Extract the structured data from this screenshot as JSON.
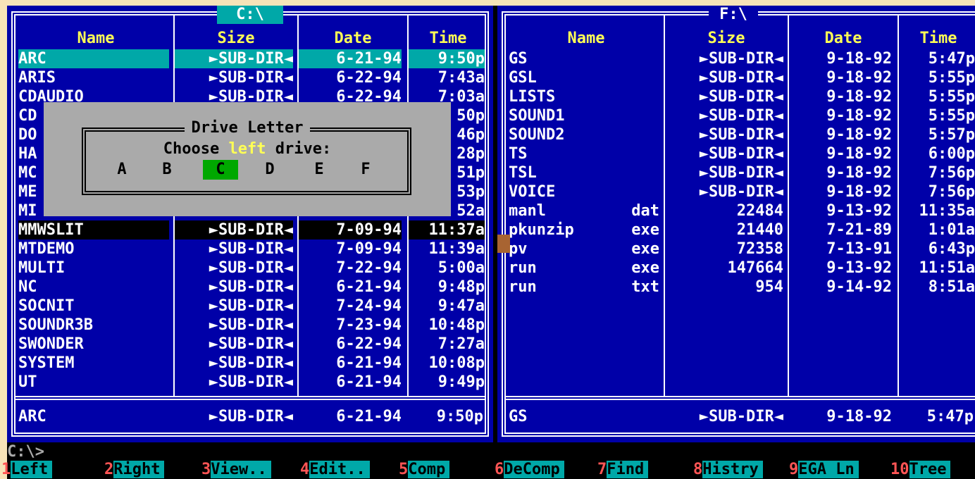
{
  "left_panel": {
    "drive": "C:\\",
    "headers": [
      "Name",
      "Size",
      "Date",
      "Time"
    ],
    "rows": [
      {
        "name": "ARC",
        "ext": "",
        "size": "►SUB-DIR◄",
        "date": "6-21-94",
        "time": "9:50p"
      },
      {
        "name": "ARIS",
        "ext": "",
        "size": "►SUB-DIR◄",
        "date": "6-22-94",
        "time": "7:43a"
      },
      {
        "name": "CDAUDIO",
        "ext": "",
        "size": "►SUB-DIR◄",
        "date": "6-22-94",
        "time": "7:03a"
      },
      {
        "name": "CD",
        "ext": "",
        "size": "",
        "date": "",
        "time": "50p"
      },
      {
        "name": "DO",
        "ext": "",
        "size": "",
        "date": "",
        "time": "46p"
      },
      {
        "name": "HA",
        "ext": "",
        "size": "",
        "date": "",
        "time": "28p"
      },
      {
        "name": "MC",
        "ext": "",
        "size": "",
        "date": "",
        "time": "51p"
      },
      {
        "name": "ME",
        "ext": "",
        "size": "",
        "date": "",
        "time": "53p"
      },
      {
        "name": "MI",
        "ext": "",
        "size": "",
        "date": "",
        "time": "52a"
      },
      {
        "name": "MMWSLIT",
        "ext": "",
        "size": "►SUB-DIR◄",
        "date": "7-09-94",
        "time": "11:37a"
      },
      {
        "name": "MTDEMO",
        "ext": "",
        "size": "►SUB-DIR◄",
        "date": "7-09-94",
        "time": "11:39a"
      },
      {
        "name": "MULTI",
        "ext": "",
        "size": "►SUB-DIR◄",
        "date": "7-22-94",
        "time": "5:00a"
      },
      {
        "name": "NC",
        "ext": "",
        "size": "►SUB-DIR◄",
        "date": "6-21-94",
        "time": "9:48p"
      },
      {
        "name": "SOCNIT",
        "ext": "",
        "size": "►SUB-DIR◄",
        "date": "7-24-94",
        "time": "9:47a"
      },
      {
        "name": "SOUNDR3B",
        "ext": "",
        "size": "►SUB-DIR◄",
        "date": "7-23-94",
        "time": "10:48p"
      },
      {
        "name": "SWONDER",
        "ext": "",
        "size": "►SUB-DIR◄",
        "date": "6-22-94",
        "time": "7:27a"
      },
      {
        "name": "SYSTEM",
        "ext": "",
        "size": "►SUB-DIR◄",
        "date": "6-21-94",
        "time": "10:08p"
      },
      {
        "name": "UT",
        "ext": "",
        "size": "►SUB-DIR◄",
        "date": "6-21-94",
        "time": "9:49p"
      }
    ],
    "status": {
      "name": "ARC",
      "size": "►SUB-DIR◄",
      "date": "6-21-94",
      "time": "9:50p"
    }
  },
  "right_panel": {
    "drive": "F:\\",
    "headers": [
      "Name",
      "Size",
      "Date",
      "Time"
    ],
    "rows": [
      {
        "name": "GS",
        "ext": "",
        "size": "►SUB-DIR◄",
        "date": "9-18-92",
        "time": "5:47p"
      },
      {
        "name": "GSL",
        "ext": "",
        "size": "►SUB-DIR◄",
        "date": "9-18-92",
        "time": "5:55p"
      },
      {
        "name": "LISTS",
        "ext": "",
        "size": "►SUB-DIR◄",
        "date": "9-18-92",
        "time": "5:55p"
      },
      {
        "name": "SOUND1",
        "ext": "",
        "size": "►SUB-DIR◄",
        "date": "9-18-92",
        "time": "5:55p"
      },
      {
        "name": "SOUND2",
        "ext": "",
        "size": "►SUB-DIR◄",
        "date": "9-18-92",
        "time": "5:57p"
      },
      {
        "name": "TS",
        "ext": "",
        "size": "►SUB-DIR◄",
        "date": "9-18-92",
        "time": "6:00p"
      },
      {
        "name": "TSL",
        "ext": "",
        "size": "►SUB-DIR◄",
        "date": "9-18-92",
        "time": "7:56p"
      },
      {
        "name": "VOICE",
        "ext": "",
        "size": "►SUB-DIR◄",
        "date": "9-18-92",
        "time": "7:56p"
      },
      {
        "name": "manl",
        "ext": "dat",
        "size": "22484",
        "date": "9-13-92",
        "time": "11:35a"
      },
      {
        "name": "pkunzip",
        "ext": "exe",
        "size": "21440",
        "date": "7-21-89",
        "time": "1:01a"
      },
      {
        "name": "pv",
        "ext": "exe",
        "size": "72358",
        "date": "7-13-91",
        "time": "6:43p"
      },
      {
        "name": "run",
        "ext": "exe",
        "size": "147664",
        "date": "9-13-92",
        "time": "11:51a"
      },
      {
        "name": "run",
        "ext": "txt",
        "size": "954",
        "date": "9-14-92",
        "time": "8:51a"
      }
    ],
    "status": {
      "name": "GS",
      "size": "►SUB-DIR◄",
      "date": "9-18-92",
      "time": "5:47p"
    }
  },
  "dialog": {
    "title": "Drive Letter",
    "prompt_before": "Choose ",
    "prompt_em": "left",
    "prompt_after": " drive:",
    "drives": [
      "A",
      "B",
      "C",
      "D",
      "E",
      "F"
    ],
    "selected_drive": "C"
  },
  "command_line": "C:\\>",
  "function_keys": [
    {
      "num": "1",
      "label": "Left"
    },
    {
      "num": "2",
      "label": "Right"
    },
    {
      "num": "3",
      "label": "View.."
    },
    {
      "num": "4",
      "label": "Edit.."
    },
    {
      "num": "5",
      "label": "Comp"
    },
    {
      "num": "6",
      "label": "DeComp"
    },
    {
      "num": "7",
      "label": "Find"
    },
    {
      "num": "8",
      "label": "Histry"
    },
    {
      "num": "9",
      "label": "EGA Ln"
    },
    {
      "num": "10",
      "label": "Tree"
    }
  ],
  "colors": {
    "panel_bg": "#0000a8",
    "highlight": "#00a8a8",
    "header_text": "#ffff55",
    "dialog_bg": "#aaaaaa",
    "selected_drive_bg": "#00a800",
    "fkey_number": "#ff5555"
  }
}
